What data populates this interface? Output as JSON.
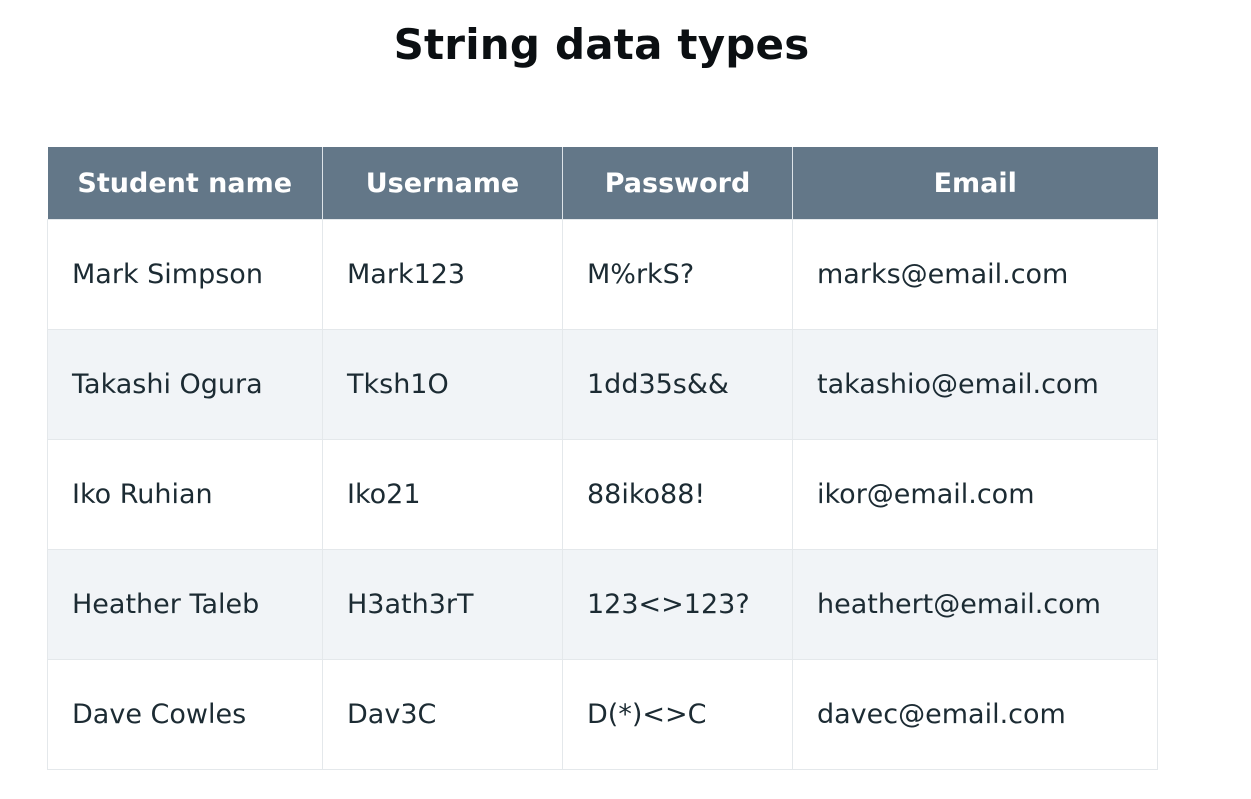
{
  "title": "String data types",
  "table": {
    "headers": [
      "Student name",
      "Username",
      "Password",
      "Email"
    ],
    "rows": [
      [
        "Mark Simpson",
        "Mark123",
        "M%rkS?",
        "marks@email.com"
      ],
      [
        "Takashi Ogura",
        "Tksh1O",
        "1dd35s&&",
        "takashio@email.com"
      ],
      [
        "Iko Ruhian",
        "Iko21",
        "88iko88!",
        "ikor@email.com"
      ],
      [
        "Heather Taleb",
        "H3ath3rT",
        "123<>123?",
        "heathert@email.com"
      ],
      [
        "Dave Cowles",
        "Dav3C",
        "D(*)<>C",
        "davec@email.com"
      ]
    ]
  },
  "colors": {
    "header_bg": "#637788",
    "header_text": "#ffffff",
    "row_alt_bg": "#f1f4f7",
    "body_text": "#1c2b33"
  }
}
